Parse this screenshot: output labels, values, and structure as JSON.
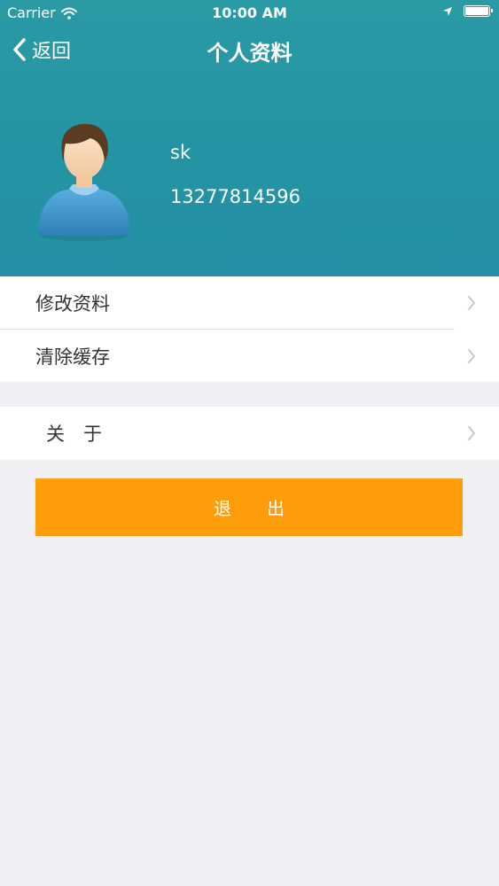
{
  "status_bar": {
    "carrier": "Carrier",
    "time": "10:00 AM"
  },
  "nav": {
    "back_label": "返回",
    "title": "个人资料"
  },
  "profile": {
    "name": "sk",
    "phone": "13277814596"
  },
  "menu": {
    "edit_profile": "修改资料",
    "clear_cache": "清除缓存",
    "about": "关　于"
  },
  "logout_label": "退　　出",
  "colors": {
    "header": "#2494a4",
    "logout": "#ff9d0b",
    "background": "#efeff4"
  }
}
